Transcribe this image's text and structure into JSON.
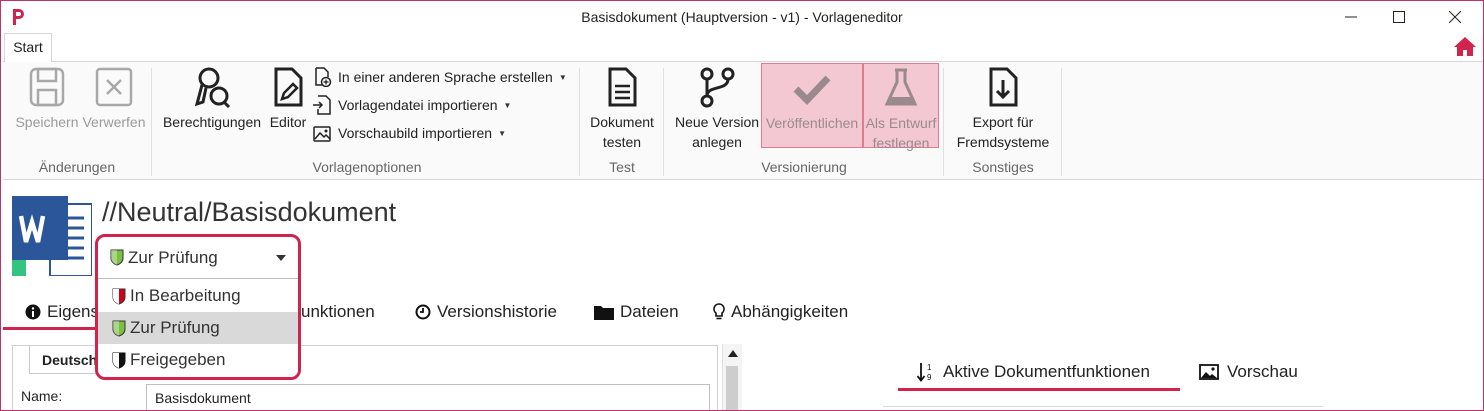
{
  "window": {
    "title": "Basisdokument (Hauptversion - v1) - Vorlageneditor"
  },
  "ribbon": {
    "tab_start": "Start",
    "groups": {
      "changes": {
        "label": "Änderungen",
        "save": "Speichern",
        "discard": "Verwerfen"
      },
      "template_options": {
        "label": "Vorlagenoptionen",
        "permissions": "Berechtigungen",
        "editor": "Editor",
        "create_language": "In einer anderen Sprache erstellen",
        "import_template": "Vorlagendatei importieren",
        "import_preview": "Vorschaubild importieren"
      },
      "test": {
        "label": "Test",
        "test_doc_line1": "Dokument",
        "test_doc_line2": "testen"
      },
      "versioning": {
        "label": "Versionierung",
        "new_version_line1": "Neue Version",
        "new_version_line2": "anlegen",
        "publish": "Veröffentlichen",
        "draft_line1": "Als Entwurf",
        "draft_line2": "festlegen"
      },
      "misc": {
        "label": "Sonstiges",
        "export_line1": "Export für",
        "export_line2": "Fremdsysteme"
      }
    }
  },
  "document": {
    "path_title": "//Neutral/Basisdokument"
  },
  "status_dropdown": {
    "selected": "Zur Prüfung",
    "options": [
      {
        "label": "In Bearbeitung",
        "color": "#d0021b"
      },
      {
        "label": "Zur Prüfung",
        "color": "#7ac143"
      },
      {
        "label": "Freigegeben",
        "color": "#111111"
      }
    ]
  },
  "content_tabs": {
    "properties_partial": "Eigens",
    "functions_partial": "unktionen",
    "history": "Versionshistorie",
    "files": "Dateien",
    "dependencies": "Abhängigkeiten"
  },
  "properties": {
    "section_tab": "Deutsch",
    "name_label": "Name:",
    "name_value": "Basisdokument"
  },
  "right_tabs": {
    "active_functions": "Aktive Dokumentfunktionen",
    "preview": "Vorschau"
  },
  "colors": {
    "accent": "#d0234e",
    "word_blue": "#2b579a",
    "word_green": "#33c481"
  }
}
